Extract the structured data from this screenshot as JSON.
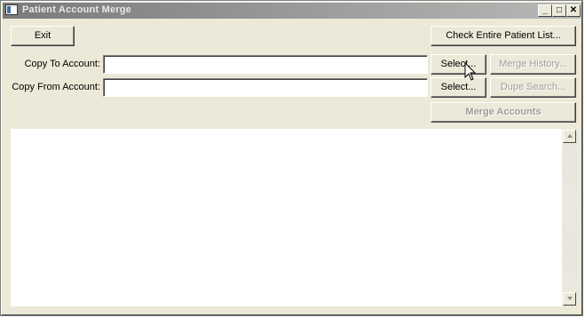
{
  "window": {
    "title": "Patient Account Merge",
    "controls": {
      "minimize": "_",
      "maximize": "□",
      "close": "✕"
    }
  },
  "toolbar": {
    "exit_label": "Exit",
    "check_list_label": "Check Entire Patient List..."
  },
  "fields": {
    "copy_to": {
      "label": "Copy To Account:",
      "value": "",
      "select_label": "Select...",
      "side_label": "Merge History..."
    },
    "copy_from": {
      "label": "Copy From Account:",
      "value": "",
      "select_label": "Select...",
      "side_label": "Dupe Search..."
    }
  },
  "actions": {
    "merge_label": "Merge Accounts"
  },
  "colors": {
    "face": "#ece9d8",
    "title_start": "#7a7a7a",
    "title_end": "#b8b8b8",
    "disabled_text": "#9c9c9c"
  },
  "icons": [
    "app-icon",
    "minimize-icon",
    "maximize-icon",
    "close-icon",
    "scroll-up-icon",
    "scroll-down-icon",
    "mouse-cursor-icon"
  ]
}
